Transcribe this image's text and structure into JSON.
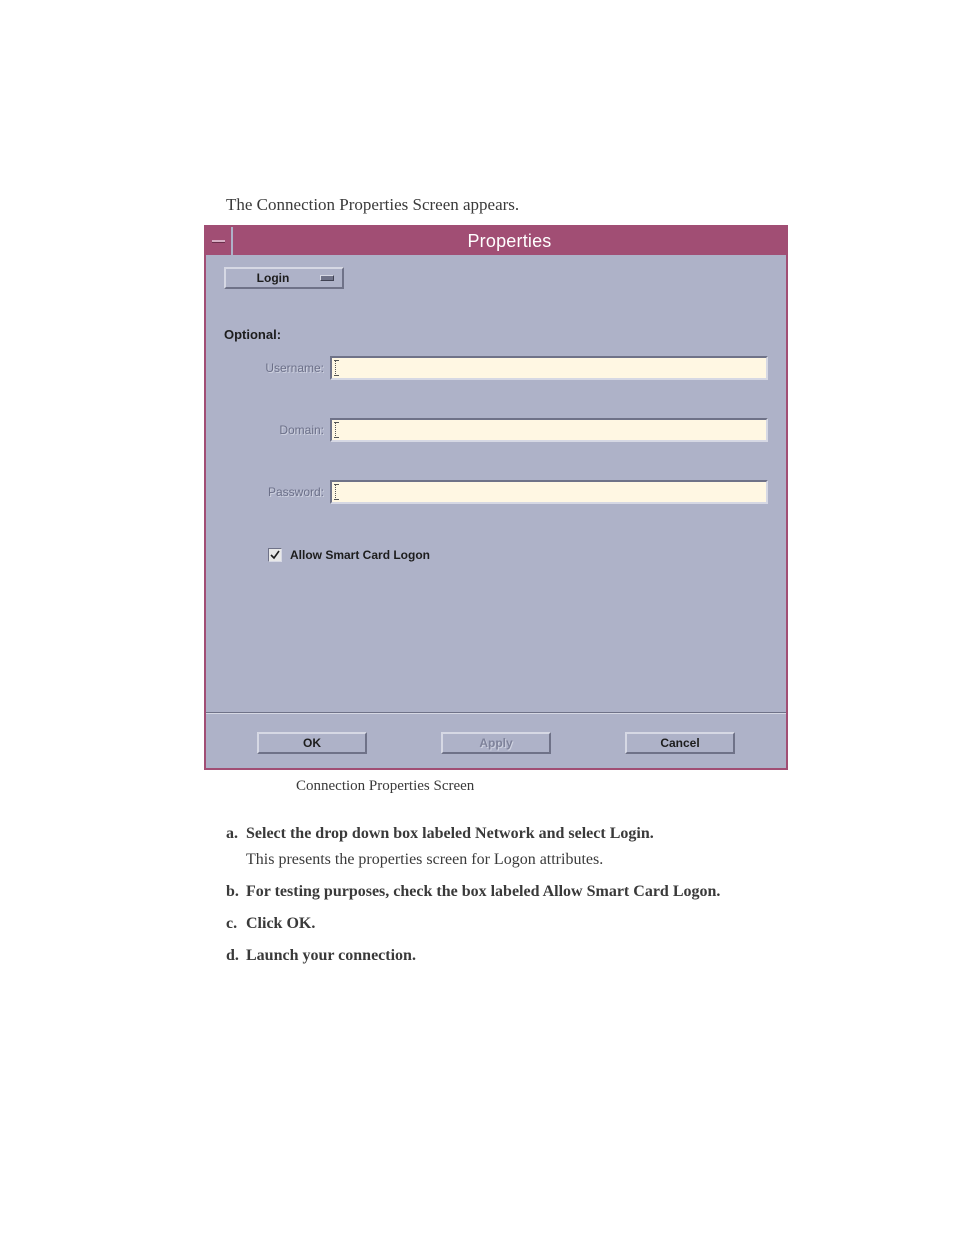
{
  "intro": "The Connection Properties Screen appears.",
  "dialog": {
    "title": "Properties",
    "dropdown_label": "Login",
    "section_label": "Optional:",
    "fields": {
      "username": {
        "label": "Username:",
        "value": ""
      },
      "domain": {
        "label": "Domain:",
        "value": ""
      },
      "password": {
        "label": "Password:",
        "value": ""
      }
    },
    "checkbox": {
      "label": "Allow Smart Card Logon",
      "checked": true
    },
    "buttons": {
      "ok": "OK",
      "apply": "Apply",
      "cancel": "Cancel"
    }
  },
  "caption": "Connection Properties Screen",
  "steps": {
    "a": {
      "letter": "a.",
      "title": "Select the drop down box labeled Network and select Login.",
      "sub": "This presents the properties screen for Logon attributes."
    },
    "b": {
      "letter": "b.",
      "title": "For testing purposes, check the box labeled Allow Smart Card Logon."
    },
    "c": {
      "letter": "c.",
      "title": "Click OK."
    },
    "d": {
      "letter": "d.",
      "title": "Launch your connection."
    }
  }
}
